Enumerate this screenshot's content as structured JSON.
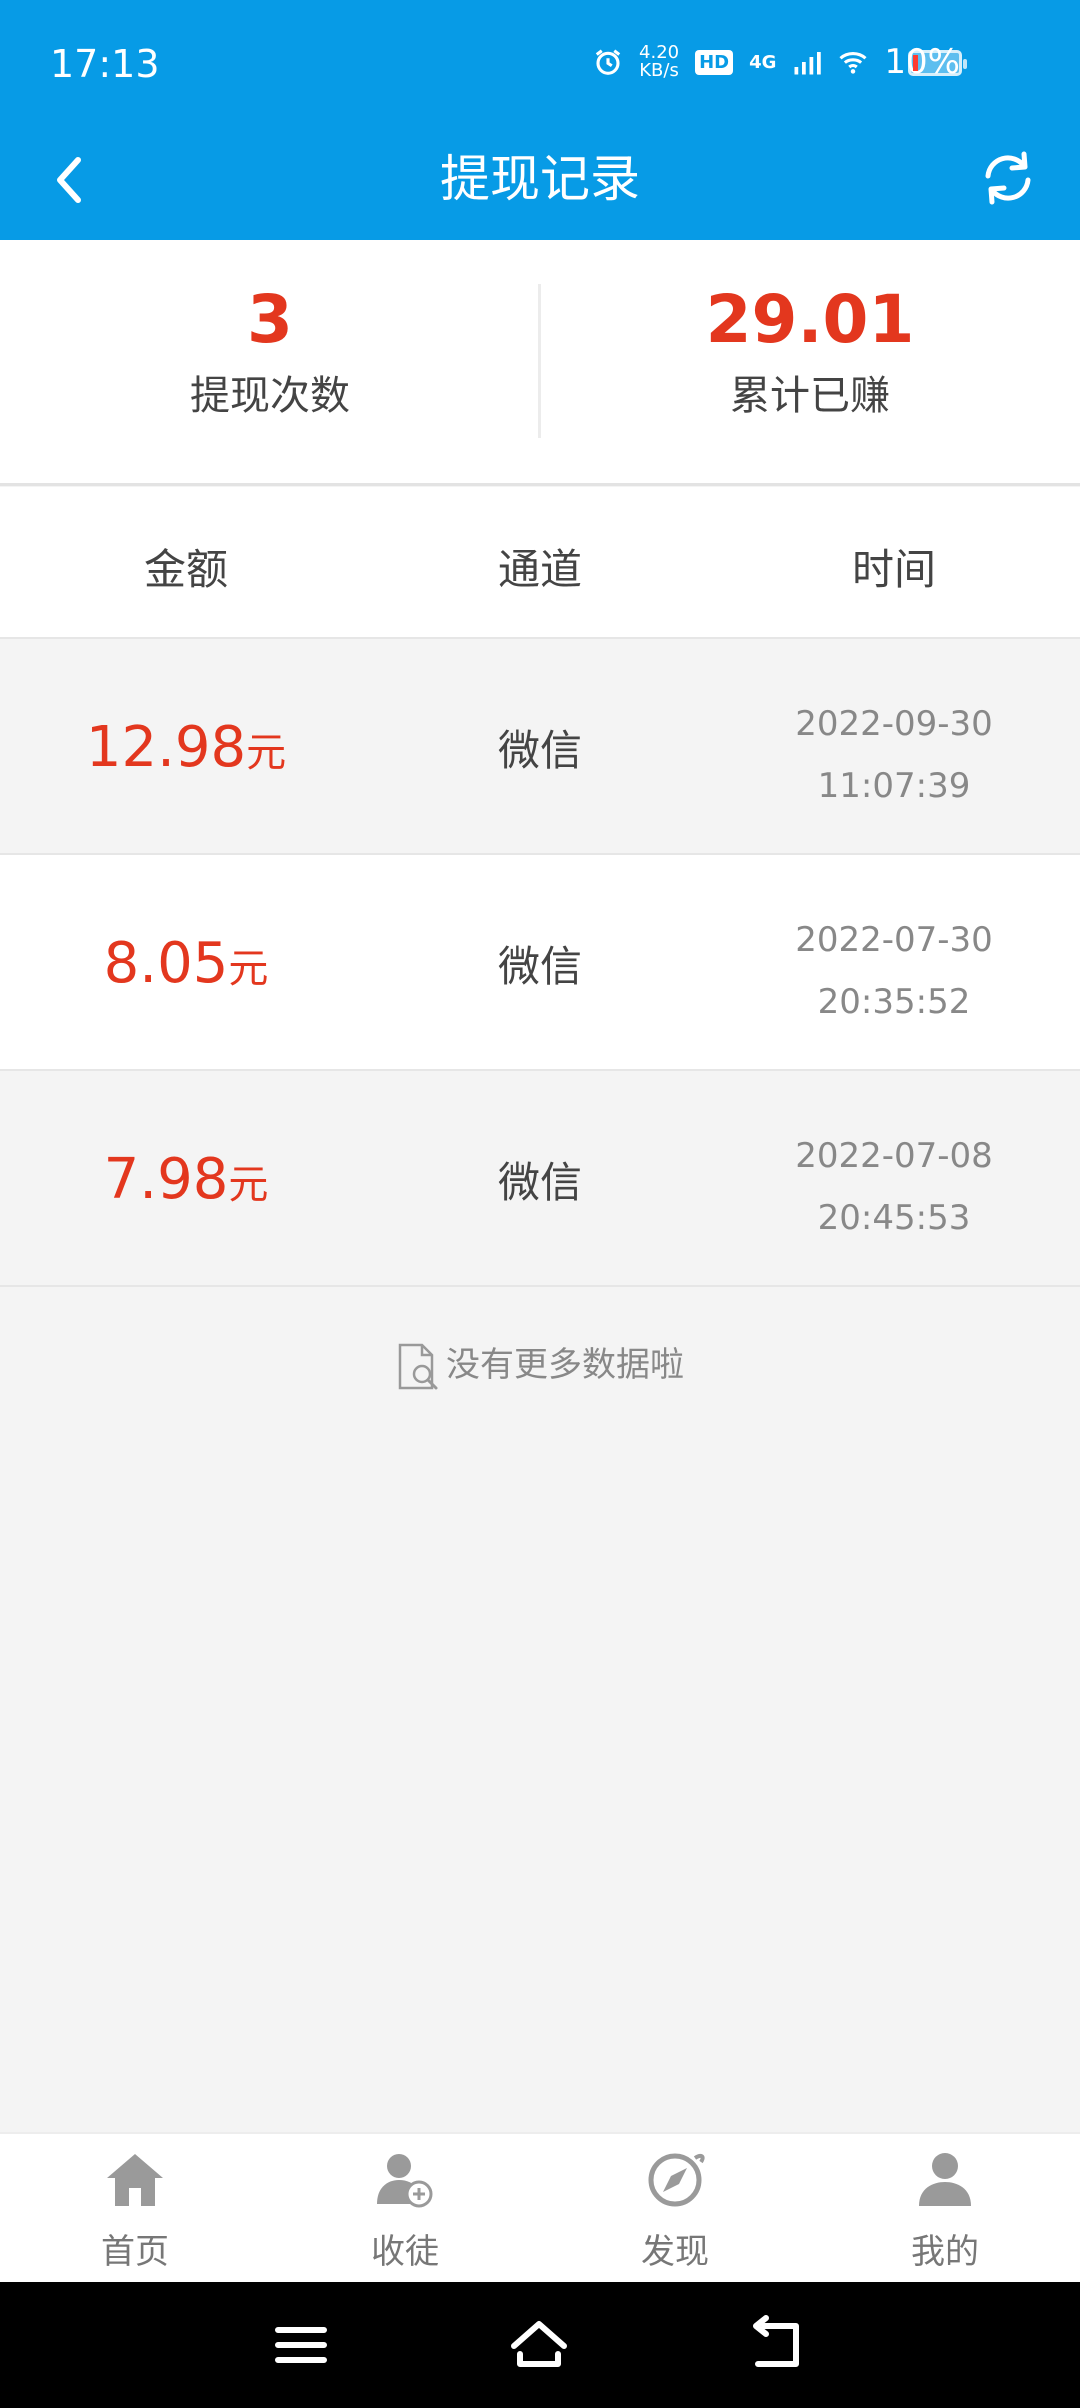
{
  "status_bar": {
    "time": "17:13",
    "net_speed": "4.20",
    "net_unit": "KB/s",
    "hd": "HD",
    "network": "4G",
    "battery": "10%"
  },
  "header": {
    "title": "提现记录"
  },
  "summary": {
    "count_value": "3",
    "count_label": "提现次数",
    "earned_value": "29.01",
    "earned_label": "累计已赚"
  },
  "table": {
    "columns": [
      "金额",
      "通道",
      "时间"
    ],
    "rows": [
      {
        "amount": "12.98",
        "unit": "元",
        "channel": "微信",
        "date": "2022-09-30",
        "time": "11:07:39"
      },
      {
        "amount": "8.05",
        "unit": "元",
        "channel": "微信",
        "date": "2022-07-30",
        "time": "20:35:52"
      },
      {
        "amount": "7.98",
        "unit": "元",
        "channel": "微信",
        "date": "2022-07-08",
        "time": "20:45:53"
      }
    ]
  },
  "empty_hint": "没有更多数据啦",
  "tabs": [
    {
      "label": "首页",
      "icon": "home-icon"
    },
    {
      "label": "收徒",
      "icon": "add-user-icon"
    },
    {
      "label": "发现",
      "icon": "compass-icon"
    },
    {
      "label": "我的",
      "icon": "person-icon"
    }
  ],
  "colors": {
    "brand_blue": "#079be6",
    "accent_red": "#e3371e"
  }
}
